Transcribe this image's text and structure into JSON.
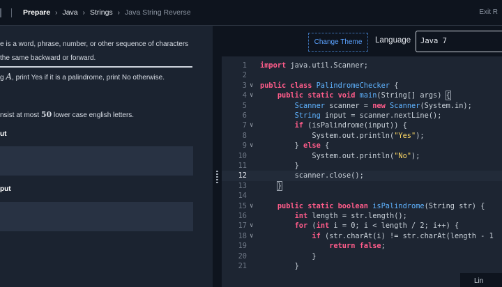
{
  "topbar": {
    "crumbs": [
      "Prepare",
      "Java",
      "Strings",
      "Java String Reverse"
    ],
    "exit": "Exit R"
  },
  "problem": {
    "intro_line1": "e is a word, phrase, number, or other sequence of characters",
    "intro_line2": "the same backward or forward.",
    "task_prefix": "g ",
    "task_var": "A",
    "task_suffix": ", print Yes if it is a palindrome, print No otherwise.",
    "constraint_prefix": "nsist at most ",
    "constraint_num": "50",
    "constraint_suffix": " lower case english letters.",
    "input_heading": "ut",
    "output_heading": "put"
  },
  "editor": {
    "change_theme": "Change Theme",
    "language_label": "Language",
    "language_value": "Java 7",
    "status": "Lin",
    "active_line": 12,
    "lines": [
      {
        "n": "1",
        "fold": "",
        "html": "<span class='kw'>import</span> java.util.Scanner;"
      },
      {
        "n": "2",
        "fold": "",
        "html": ""
      },
      {
        "n": "3",
        "fold": "v",
        "html": "<span class='kw'>public class</span> <span class='ty'>PalindromeChecker</span> {"
      },
      {
        "n": "4",
        "fold": "v",
        "html": "    <span class='kw'>public static void</span> <span class='fn'>main</span>(String[] args) <span class='cur'>{</span>"
      },
      {
        "n": "5",
        "fold": "",
        "html": "        <span class='ty'>Scanner</span> scanner = <span class='kw'>new</span> <span class='ty'>Scanner</span>(System.in);"
      },
      {
        "n": "6",
        "fold": "",
        "html": "        <span class='ty'>String</span> input = scanner.nextLine();"
      },
      {
        "n": "7",
        "fold": "v",
        "html": "        <span class='kw'>if</span> (isPalindrome(input)) {"
      },
      {
        "n": "8",
        "fold": "",
        "html": "            System.out.println(<span class='st'>\"Yes\"</span>);"
      },
      {
        "n": "9",
        "fold": "v",
        "html": "        } <span class='kw'>else</span> {"
      },
      {
        "n": "10",
        "fold": "",
        "html": "            System.out.println(<span class='st'>\"No\"</span>);"
      },
      {
        "n": "11",
        "fold": "",
        "html": "        }"
      },
      {
        "n": "12",
        "fold": "",
        "html": "        scanner.close();"
      },
      {
        "n": "13",
        "fold": "",
        "html": "    <span class='cur'>}</span>"
      },
      {
        "n": "14",
        "fold": "",
        "html": ""
      },
      {
        "n": "15",
        "fold": "v",
        "html": "    <span class='kw'>public static boolean</span> <span class='fn'>isPalindrome</span>(String str) {"
      },
      {
        "n": "16",
        "fold": "",
        "html": "        <span class='kw'>int</span> length = str.length();"
      },
      {
        "n": "17",
        "fold": "v",
        "html": "        <span class='kw'>for</span> (<span class='kw'>int</span> i = 0; i &lt; length / 2; i++) {"
      },
      {
        "n": "18",
        "fold": "v",
        "html": "            <span class='kw'>if</span> (str.charAt(i) != str.charAt(length - 1"
      },
      {
        "n": "19",
        "fold": "",
        "html": "                <span class='kw'>return false</span>;"
      },
      {
        "n": "20",
        "fold": "",
        "html": "            }"
      },
      {
        "n": "21",
        "fold": "",
        "html": "        }"
      }
    ]
  }
}
